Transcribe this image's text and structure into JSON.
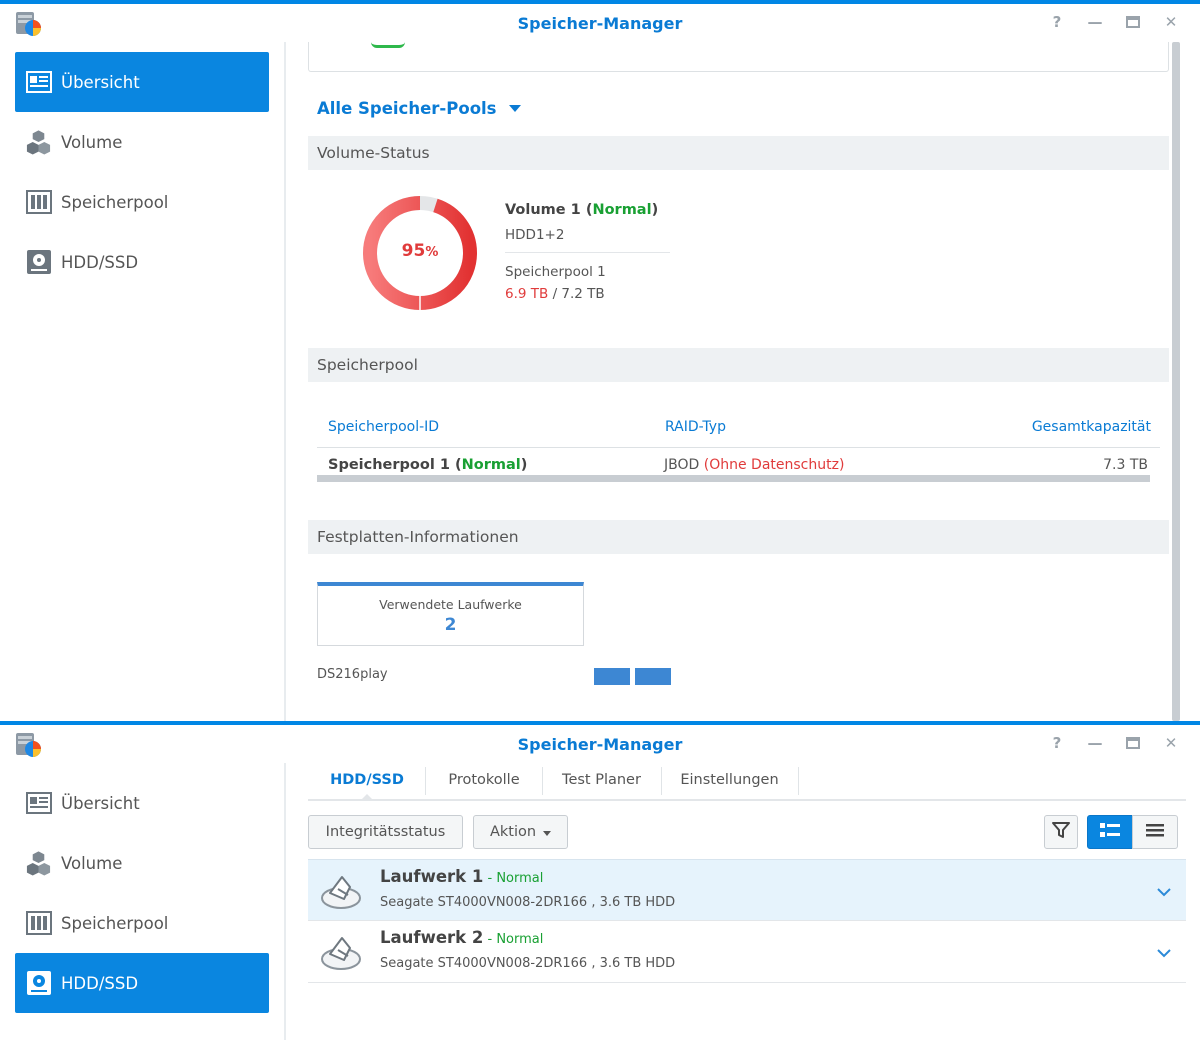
{
  "app": {
    "title": "Speicher-Manager"
  },
  "window_controls": [
    "help-icon",
    "minimize-icon",
    "maximize-icon",
    "close-icon"
  ],
  "sidebar": {
    "items": [
      {
        "label": "Übersicht",
        "icon": "overview-icon"
      },
      {
        "label": "Volume",
        "icon": "volume-cubes-icon"
      },
      {
        "label": "Speicherpool",
        "icon": "storage-pool-icon"
      },
      {
        "label": "HDD/SSD",
        "icon": "hdd-icon"
      }
    ]
  },
  "overview": {
    "pool_filter": "Alle Speicher-Pools",
    "volume_status": {
      "heading": "Volume-Status",
      "usage_percent": 95,
      "percent_text": "95",
      "percent_sign": "%",
      "volume_name": "Volume 1",
      "volume_state": "Normal",
      "disks": "HDD1+2",
      "pool": "Speicherpool 1",
      "used": "6.9 TB",
      "separator": " / ",
      "total": "7.2 TB"
    },
    "storage_pool": {
      "heading": "Speicherpool",
      "columns": [
        "Speicherpool-ID",
        "RAID-Typ",
        "Gesamtkapazität"
      ],
      "row": {
        "name": "Speicherpool 1",
        "state": "Normal",
        "raid": "JBOD",
        "raid_note": "(Ohne Datenschutz)",
        "capacity": "7.3 TB"
      }
    },
    "disk_info": {
      "heading": "Festplatten-Informationen",
      "used_drives_label": "Verwendete Laufwerke",
      "used_drives_count": "2",
      "device": "DS216play"
    }
  },
  "hdd": {
    "tabs": [
      "HDD/SSD",
      "Protokolle",
      "Test Planer",
      "Einstellungen"
    ],
    "toolbar": {
      "integrity_label": "Integritätsstatus",
      "action_label": "Aktion"
    },
    "drives": [
      {
        "name": "Laufwerk 1",
        "dash": " - ",
        "status": "Normal",
        "desc": "Seagate ST4000VN008-2DR166 , 3.6 TB HDD"
      },
      {
        "name": "Laufwerk 2",
        "dash": " - ",
        "status": "Normal",
        "desc": "Seagate ST4000VN008-2DR166 , 3.6 TB HDD"
      }
    ]
  },
  "colors": {
    "accent": "#0a86e0",
    "normal": "#19a033",
    "warning": "#e03b3b"
  }
}
